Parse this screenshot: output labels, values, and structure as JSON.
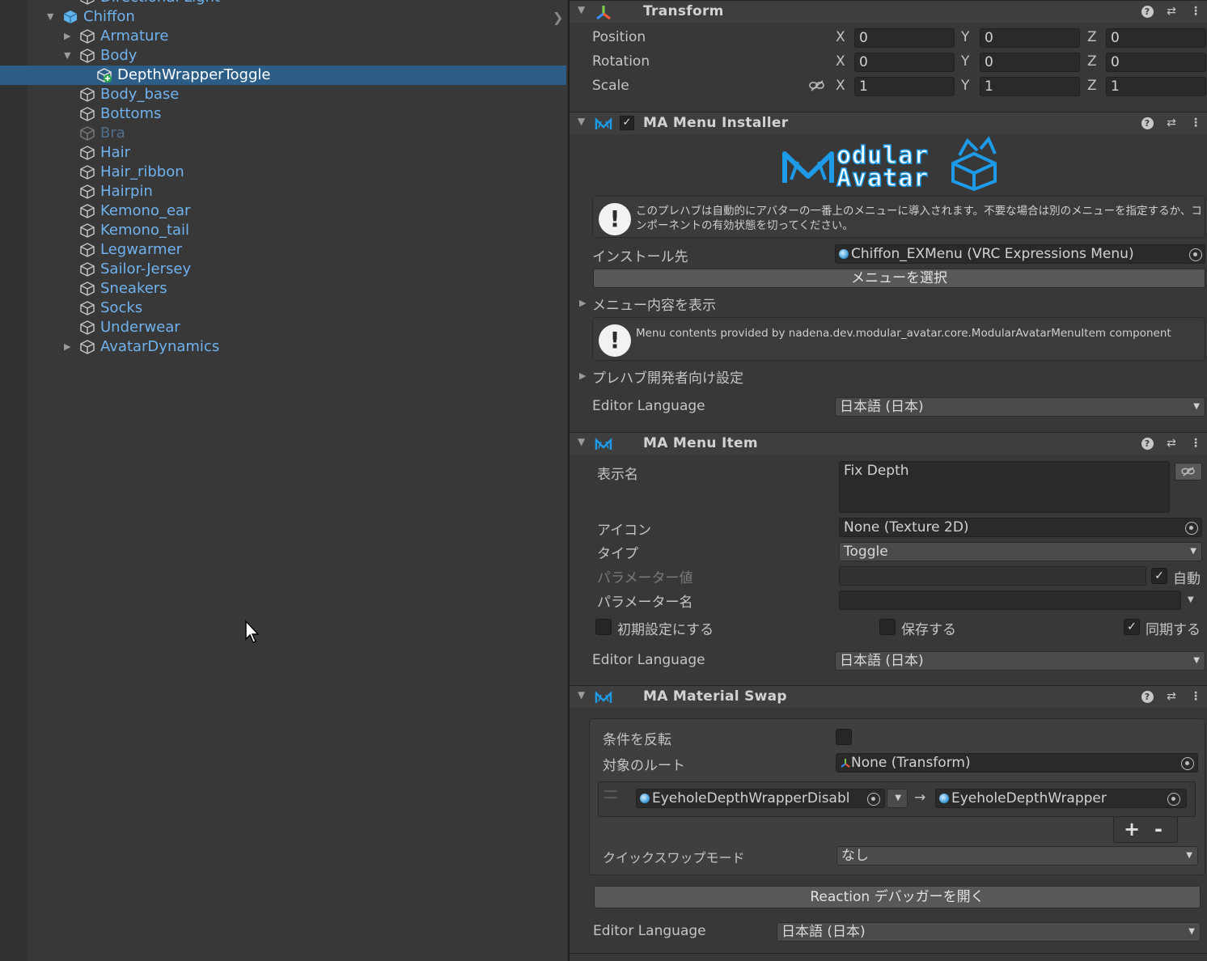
{
  "hierarchy": {
    "items": [
      {
        "label": "Directional Light",
        "depth": 1,
        "arrow": "",
        "dim": false,
        "selected": false
      },
      {
        "label": "Chiffon",
        "depth": 0,
        "arrow": "down",
        "dim": false,
        "selected": false,
        "prefab_root": true
      },
      {
        "label": "Armature",
        "depth": 1,
        "arrow": "right",
        "dim": false,
        "selected": false
      },
      {
        "label": "Body",
        "depth": 1,
        "arrow": "down",
        "dim": false,
        "selected": false
      },
      {
        "label": "DepthWrapperToggle",
        "depth": 2,
        "arrow": "",
        "dim": false,
        "selected": true,
        "added": true
      },
      {
        "label": "Body_base",
        "depth": 1,
        "arrow": "",
        "dim": false,
        "selected": false
      },
      {
        "label": "Bottoms",
        "depth": 1,
        "arrow": "",
        "dim": false,
        "selected": false
      },
      {
        "label": "Bra",
        "depth": 1,
        "arrow": "",
        "dim": true,
        "selected": false
      },
      {
        "label": "Hair",
        "depth": 1,
        "arrow": "",
        "dim": false,
        "selected": false
      },
      {
        "label": "Hair_ribbon",
        "depth": 1,
        "arrow": "",
        "dim": false,
        "selected": false
      },
      {
        "label": "Hairpin",
        "depth": 1,
        "arrow": "",
        "dim": false,
        "selected": false
      },
      {
        "label": "Kemono_ear",
        "depth": 1,
        "arrow": "",
        "dim": false,
        "selected": false
      },
      {
        "label": "Kemono_tail",
        "depth": 1,
        "arrow": "",
        "dim": false,
        "selected": false
      },
      {
        "label": "Legwarmer",
        "depth": 1,
        "arrow": "",
        "dim": false,
        "selected": false
      },
      {
        "label": "Sailor-Jersey",
        "depth": 1,
        "arrow": "",
        "dim": false,
        "selected": false
      },
      {
        "label": "Sneakers",
        "depth": 1,
        "arrow": "",
        "dim": false,
        "selected": false
      },
      {
        "label": "Socks",
        "depth": 1,
        "arrow": "",
        "dim": false,
        "selected": false
      },
      {
        "label": "Underwear",
        "depth": 1,
        "arrow": "",
        "dim": false,
        "selected": false
      },
      {
        "label": "AvatarDynamics",
        "depth": 1,
        "arrow": "right",
        "dim": false,
        "selected": false
      }
    ]
  },
  "transform": {
    "title": "Transform",
    "rows": [
      {
        "label": "Position",
        "x": "0",
        "y": "0",
        "z": "0"
      },
      {
        "label": "Rotation",
        "x": "0",
        "y": "0",
        "z": "0"
      },
      {
        "label": "Scale",
        "x": "1",
        "y": "1",
        "z": "1"
      }
    ],
    "axes": [
      "X",
      "Y",
      "Z"
    ]
  },
  "menu_installer": {
    "title": "MA Menu Installer",
    "logo_text_1": "odular",
    "logo_text_2": "Avatar",
    "help_text": "このプレハブは自動的にアバターの一番上のメニューに導入されます。不要な場合は別のメニューを指定するか、コンポーネントの有効状態を切ってください。",
    "install_target_label": "インストール先",
    "install_target_value": "Chiffon_EXMenu (VRC Expressions Menu)",
    "select_menu_button": "メニューを選択",
    "show_menu_contents": "メニュー内容を表示",
    "contents_help": "Menu contents provided by nadena.dev.modular_avatar.core.ModularAvatarMenuItem component",
    "prefab_dev_settings": "プレハブ開発者向け設定",
    "editor_language_label": "Editor Language",
    "editor_language_value": "日本語 (日本)"
  },
  "menu_item": {
    "title": "MA Menu Item",
    "display_name_label": "表示名",
    "display_name_value": "Fix Depth",
    "icon_label": "アイコン",
    "icon_value": "None (Texture 2D)",
    "type_label": "タイプ",
    "type_value": "Toggle",
    "param_value_label": "パラメーター値",
    "param_value": "",
    "auto_label": "自動",
    "param_name_label": "パラメーター名",
    "param_name_value": "",
    "default_label": "初期設定にする",
    "saved_label": "保存する",
    "synced_label": "同期する",
    "editor_language_label": "Editor Language",
    "editor_language_value": "日本語 (日本)",
    "auto_checked": true,
    "default_checked": false,
    "saved_checked": false,
    "synced_checked": true
  },
  "material_swap": {
    "title": "MA Material Swap",
    "invert_label": "条件を反転",
    "invert_checked": false,
    "root_label": "対象のルート",
    "root_value": "None (Transform)",
    "swap_from": "EyeholeDepthWrapperDisabl",
    "arrow": "→",
    "swap_to": "EyeholeDepthWrapper",
    "add_label": "+",
    "remove_label": "-",
    "quick_swap_label": "クイックスワップモード",
    "quick_swap_value": "なし",
    "debugger_button": "Reaction デバッガーを開く",
    "editor_language_label": "Editor Language",
    "editor_language_value": "日本語 (日本)"
  },
  "colors": {
    "accent": "#2c5d87",
    "hierarchy_text": "#6fb2ef",
    "panel_bg": "#383838",
    "logo_blue": "#1e9be8"
  }
}
